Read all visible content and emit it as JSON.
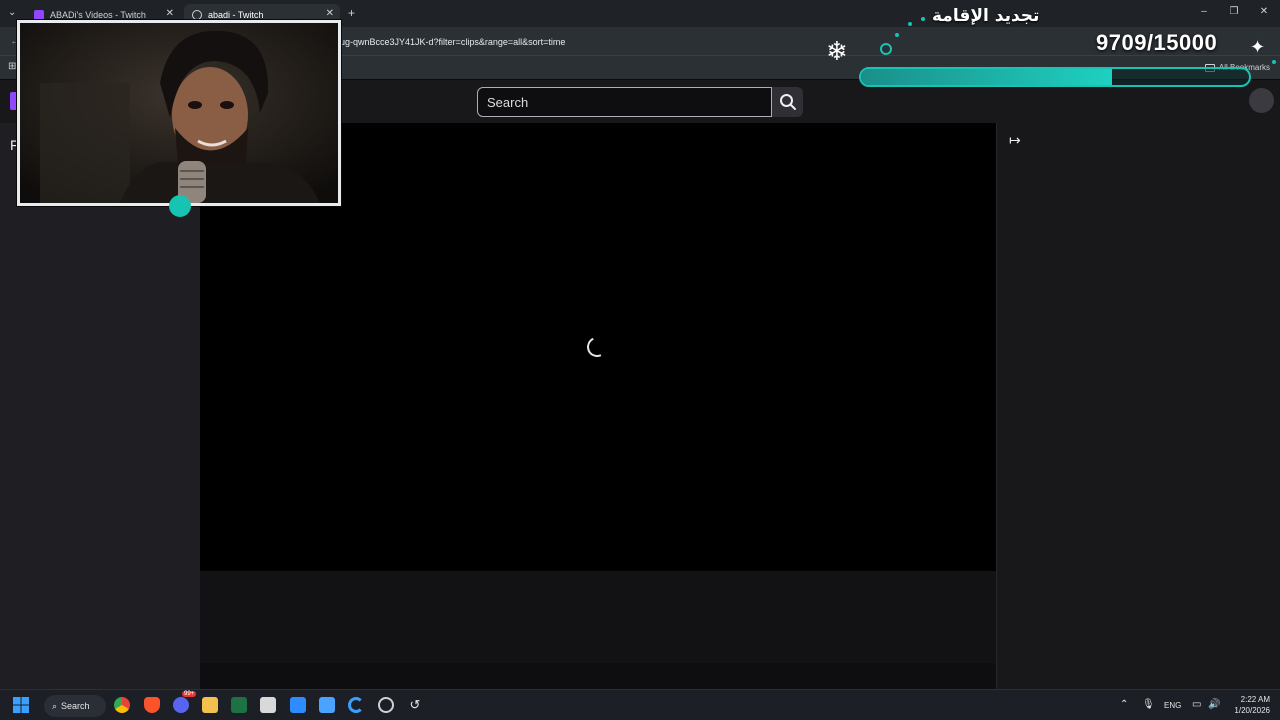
{
  "browser": {
    "tabs": [
      {
        "label": "ABADi's Videos - Twitch",
        "active": false
      },
      {
        "label": "abadi - Twitch",
        "active": true
      }
    ],
    "new_tab_symbol": "+",
    "url_visible": "ug-qwnBcce3JY41JK-d?filter=clips&range=all&sort=time",
    "all_bookmarks_label": "All Bookmarks"
  },
  "twitch": {
    "search_placeholder": "Search",
    "sidebar_initial": "F"
  },
  "overlay": {
    "goal_title": "تجديد الإقامة",
    "goal_count": "9709/15000",
    "goal_progress": 0.647,
    "accent_color": "#17c3b2"
  },
  "taskbar": {
    "search_label": "Search",
    "language": "ENG",
    "time": "2:22 AM",
    "date": "1/20/2026",
    "discord_badge": "99+"
  },
  "colors": {
    "twitch_purple": "#9146ff",
    "page_bg": "#0e0e10"
  }
}
